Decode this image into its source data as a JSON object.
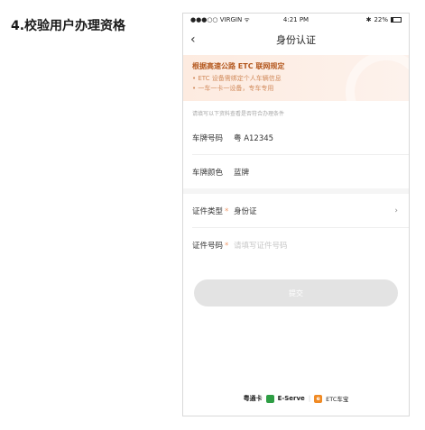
{
  "step_title": "4.校验用户办理资格",
  "status_bar": {
    "carrier": "●●●○○ VIRGIN ᯤ",
    "time": "4:21 PM",
    "bluetooth": "✱",
    "battery_text": "22%",
    "battery_level": 0.22
  },
  "nav": {
    "back_glyph": "‹",
    "title": "身份认证"
  },
  "notice": {
    "heading": "根据高速公路 ETC 联网规定",
    "lines": [
      "• ETC 设备需绑定个人车辆信息",
      "• 一车一卡一设备，专车专用"
    ]
  },
  "hint": "请填写以下资料查看是否符合办理条件",
  "vehicle": {
    "plate_label": "车牌号码",
    "plate_value": "粤 A12345",
    "color_label": "车牌颜色",
    "color_value": "蓝牌"
  },
  "id_form": {
    "type_label": "证件类型",
    "type_value": "身份证",
    "number_label": "证件号码",
    "number_placeholder": "请填写证件号码",
    "required_mark": "*",
    "chevron": "›"
  },
  "submit_label": "提交",
  "footer": {
    "brand1": "粤通卡",
    "brand2": "E-Serve",
    "separator": "|",
    "etc_icon_text": "e",
    "brand3": "ETC车宝"
  },
  "colors": {
    "accent": "#f08a24",
    "notice_heading": "#b4581f",
    "required": "#f09a6a",
    "submit_disabled": "#e3e3e3"
  }
}
